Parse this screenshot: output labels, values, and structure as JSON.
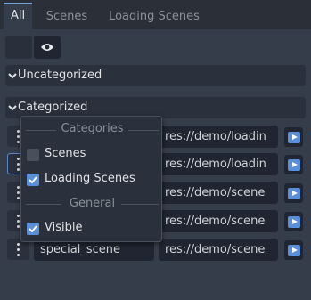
{
  "tabs": [
    {
      "label": "All",
      "active": true
    },
    {
      "label": "Scenes",
      "active": false
    },
    {
      "label": "Loading Scenes",
      "active": false
    }
  ],
  "toolbar": {
    "eye_icon": "eye-icon"
  },
  "sections": {
    "uncategorized": "Uncategorized",
    "categorized": "Categorized"
  },
  "rows": [
    {
      "name": "",
      "path": "res://demo/loadin"
    },
    {
      "name": "",
      "path": "res://demo/loadin"
    },
    {
      "name": "",
      "path": "res://demo/scene"
    },
    {
      "name": "",
      "path": "res://demo/scene"
    },
    {
      "name": "special_scene",
      "path": "res://demo/scene_"
    }
  ],
  "popup": {
    "categories_title": "Categories",
    "general_title": "General",
    "options": [
      {
        "label": "Scenes",
        "checked": false
      },
      {
        "label": "Loading Scenes",
        "checked": true
      },
      {
        "label": "Visible",
        "checked": true
      }
    ]
  },
  "colors": {
    "accent": "#5b8fd8",
    "background": "#363d4a"
  }
}
